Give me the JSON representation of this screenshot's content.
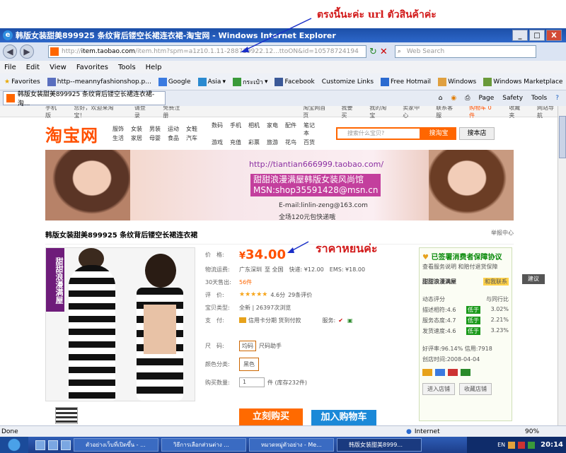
{
  "annotations": {
    "url_note": "ตรงนี้นะค่ะ url ตัวสินค้าค่ะ",
    "price_note": "ราคาหยนค่ะ"
  },
  "window": {
    "title": "韩版女装甜美899925 条纹背后镂空长裙连衣裙-淘宝网 - Windows Internet Explorer",
    "controls": [
      "_",
      "□",
      "X"
    ]
  },
  "addressbar": {
    "url_prefix": "http://",
    "url_domain": "item.taobao.com",
    "url_rest": "/item.htm?spm=a1z10.1.11-288739922.12...ttoON&id=10578724194",
    "search_placeholder": "Web Search"
  },
  "menu": [
    "File",
    "Edit",
    "View",
    "Favorites",
    "Tools",
    "Help"
  ],
  "favorites": {
    "label": "Favorites",
    "items": [
      {
        "label": "http--meannyfashionshop.p...",
        "color": "#5a6fbf"
      },
      {
        "label": "Google",
        "color": "#3a7ae0"
      },
      {
        "label": "Asia",
        "color": "#2a8ad0"
      },
      {
        "label": "กระเป๋า",
        "color": "#3a9a3a"
      },
      {
        "label": "Facebook",
        "color": "#3b5998"
      },
      {
        "label": "Customize Links",
        "color": "#e6a030"
      },
      {
        "label": "Free Hotmail",
        "color": "#2a6ad0"
      },
      {
        "label": "Windows",
        "color": "#e0a040"
      },
      {
        "label": "Windows Marketplace",
        "color": "#6a9a3a"
      }
    ]
  },
  "tab": {
    "label": "韩版女装甜美899925 条纹背后镂空长裙连衣裙-淘...",
    "tools": [
      "Page",
      "Safety",
      "Tools"
    ]
  },
  "taobao": {
    "topbar_left": [
      "手机版",
      "您好，欢迎来淘宝！",
      "请登录",
      "免费注册"
    ],
    "topbar_right": [
      "淘宝网首页",
      "我要买",
      "我的淘宝",
      "卖家中心",
      "联系客服",
      "购物车 0 件",
      "收藏夹",
      "网站导航"
    ],
    "logo": "淘宝网",
    "cats1": [
      "服饰",
      "女装",
      "男装",
      "运动",
      "女鞋",
      "箱包",
      "生活",
      "家居",
      "母婴",
      "食品",
      "汽车",
      "保险"
    ],
    "cats2": [
      "数码",
      "手机",
      "相机",
      "家电",
      "配件",
      "笔记本",
      "游戏",
      "充值",
      "彩票",
      "旅游",
      "花鸟",
      "百货"
    ],
    "search_placeholder": "搜索什么宝贝?",
    "search_button": "搜淘宝",
    "search_shop_button": "搜本店"
  },
  "banner": {
    "url": "http://tiantian666999.taobao.com/",
    "shop": "甜甜浪漫满屋韩版女装风尚馆",
    "msn": "MSN:shop35591428@msn.cn",
    "email": "E-mail:linlin-zeng@163.com",
    "promo": "全场120元包快递哦"
  },
  "product": {
    "title": "韩版女装甜美899925 条纹背后镂空长裙连衣裙",
    "report": "举报中心",
    "image_label": "甜甜浪漫满屋",
    "price_label": "价　格:",
    "price_symbol": "¥",
    "price": "34.00",
    "shipping_label": "物流运费:",
    "shipping_from": "广东深圳",
    "shipping_to": "至 全国",
    "express": "快递: ¥12.00",
    "ems": "EMS: ¥18.00",
    "sales_label": "30天售出:",
    "sales": "56件",
    "rating_label": "评　价:",
    "rating_stars": "★★★★★",
    "rating": "4.6分",
    "reviews": "29条评价",
    "credit_label": "宝贝类型:",
    "credit": "全新 | 26397次浏览",
    "pay_label": "支　付:",
    "pay": "信用卡分期  货到付款",
    "service_label": "服务:",
    "size_label": "尺　码:",
    "size": "均码",
    "size_help": "尺码助手",
    "color_label": "颜色分类:",
    "color": "黑色",
    "qty_label": "购买数量:",
    "qty": "1",
    "stock": "件 (库存232件)",
    "buy": "立刻购买",
    "cart": "加入购物车"
  },
  "sidebar": {
    "guarantee": "已签署消费者保障协议",
    "guarantee_sub": "查看服务说明 和赔付退货保障",
    "shop_name": "甜甜浪漫满屋",
    "contact": "和我联系",
    "score_title": "动态评分",
    "compare": "与同行比",
    "scores": [
      {
        "k": "描述相符:4.6",
        "tag": "低于",
        "v": "3.02%"
      },
      {
        "k": "服务态度:4.7",
        "tag": "低于",
        "v": "2.21%"
      },
      {
        "k": "发货速度:4.6",
        "tag": "低于",
        "v": "3.23%"
      }
    ],
    "good_rate": "好评率:96.14%  信用:7918",
    "since": "创店时间:2008-04-04",
    "enter": "进入店铺",
    "fav": "收藏店铺"
  },
  "feedback": "建议",
  "status": {
    "left": "Done",
    "zone": "Internet",
    "zoom": "90%"
  },
  "taskbar": {
    "items": [
      "ตัวอย่างเว็บที่เปิดขึ้น - ...",
      "วิธีการเลือกส่วนต่าง ...",
      "หมวดหมู่ตัวอย่าง - Me...",
      "韩版女装甜美8999..."
    ],
    "lang": "EN",
    "clock": "20:14"
  }
}
